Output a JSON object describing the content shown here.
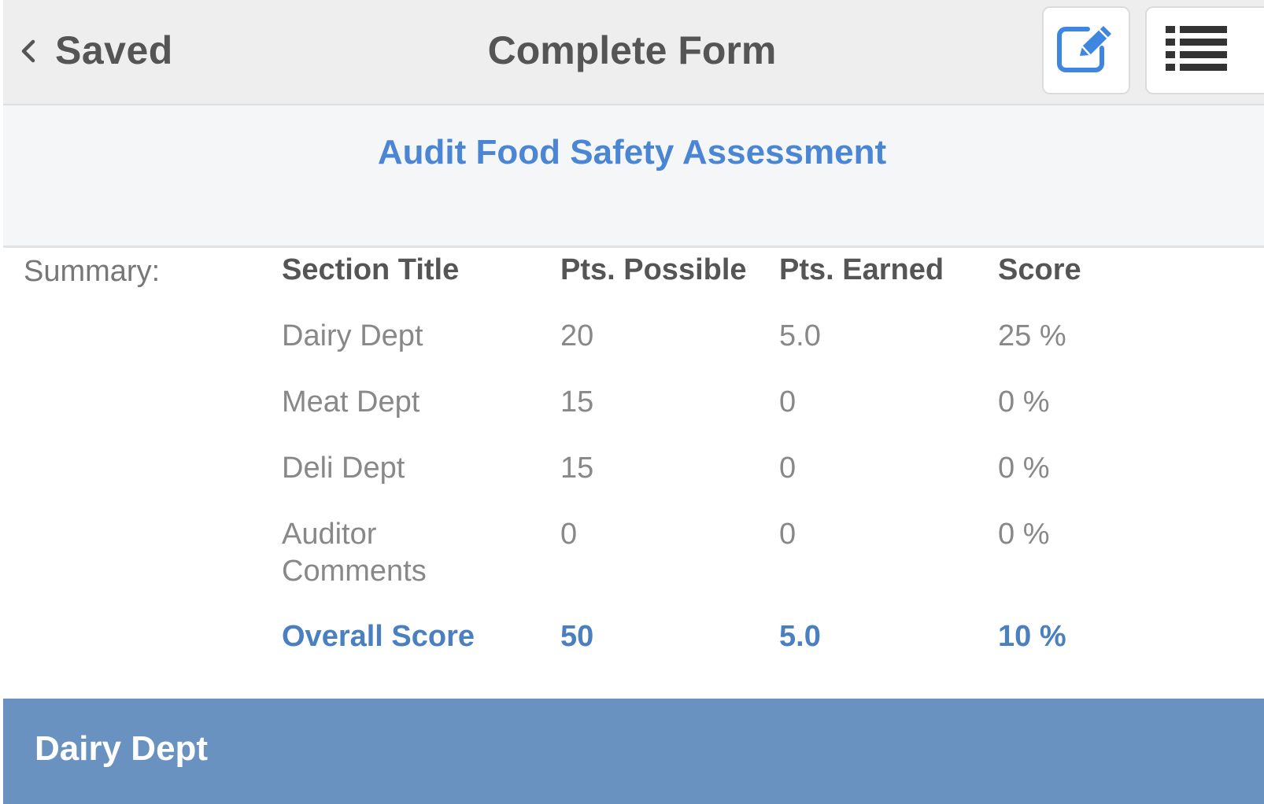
{
  "header": {
    "back_label": "Saved",
    "title": "Complete Form",
    "icons": {
      "back": "chevron-left-icon",
      "edit": "edit-note-icon",
      "list": "list-icon"
    }
  },
  "form": {
    "title": "Audit Food Safety Assessment"
  },
  "summary": {
    "label": "Summary:",
    "columns": [
      "Section Title",
      "Pts. Possible",
      "Pts. Earned",
      "Score"
    ],
    "rows": [
      [
        "Dairy Dept",
        "20",
        "5.0",
        "25 %"
      ],
      [
        "Meat Dept",
        "15",
        "0",
        "0 %"
      ],
      [
        "Deli Dept",
        "15",
        "0",
        "0 %"
      ],
      [
        "Auditor Comments",
        "0",
        "0",
        "0 %"
      ]
    ],
    "total": [
      "Overall Score",
      "50",
      "5.0",
      "10 %"
    ]
  },
  "section": {
    "title": "Dairy Dept"
  },
  "colors": {
    "accent": "#4a86d4",
    "section_band": "#6a92c0",
    "header_bg": "#eeeeee"
  }
}
